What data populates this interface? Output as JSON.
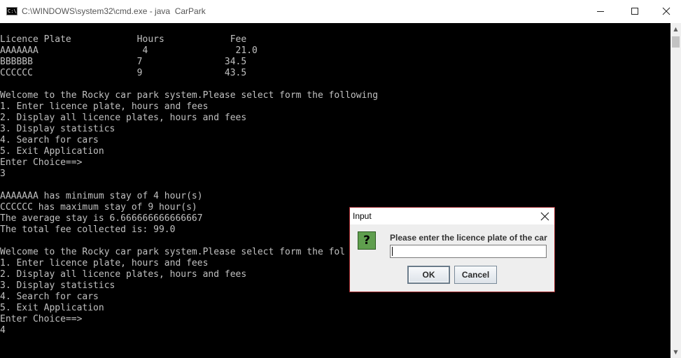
{
  "window": {
    "title": "C:\\WINDOWS\\system32\\cmd.exe - java  CarPark",
    "icon": "cmd-icon",
    "icon_text": "C:\\."
  },
  "console": {
    "lines": [
      "Licence Plate            Hours            Fee",
      "AAAAAAA                   4                21.0",
      "BBBBBB                   7               34.5",
      "CCCCCC                   9               43.5",
      "",
      "Welcome to the Rocky car park system.Please select form the following",
      "1. Enter licence plate, hours and fees",
      "2. Display all licence plates, hours and fees",
      "3. Display statistics",
      "4. Search for cars",
      "5. Exit Application",
      "Enter Choice==>",
      "3",
      "",
      "AAAAAAA has minimum stay of 4 hour(s)",
      "CCCCCC has maximum stay of 9 hour(s)",
      "The average stay is 6.666666666666667",
      "The total fee collected is: 99.0",
      "",
      "Welcome to the Rocky car park system.Please select form the fol",
      "1. Enter licence plate, hours and fees",
      "2. Display all licence plates, hours and fees",
      "3. Display statistics",
      "4. Search for cars",
      "5. Exit Application",
      "Enter Choice==>",
      "4"
    ]
  },
  "dialog": {
    "title": "Input",
    "icon": "question-icon",
    "icon_glyph": "?",
    "message": "Please enter the licence plate of the car",
    "input_value": "",
    "ok_label": "OK",
    "cancel_label": "Cancel"
  },
  "colors": {
    "console_bg": "#000000",
    "console_text": "#c0c0c0",
    "dialog_border": "#a0262a",
    "question_icon": "#5f9e4e"
  }
}
